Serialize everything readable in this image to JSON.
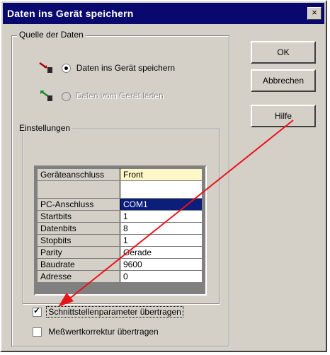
{
  "window": {
    "title": "Daten ins Gerät speichern",
    "close_glyph": "×"
  },
  "source_group": {
    "label": "Quelle der Daten",
    "options": [
      {
        "label": "Daten ins Gerät speichern",
        "selected": true,
        "enabled": true,
        "icon": "upload-arrow-icon"
      },
      {
        "label": "Daten vom Gerät laden",
        "selected": false,
        "enabled": false,
        "icon": "download-arrow-icon"
      }
    ]
  },
  "buttons": {
    "ok": "OK",
    "cancel": "Abbrechen",
    "help": "Hilfe"
  },
  "settings": {
    "label": "Einstellungen",
    "rows": [
      {
        "key": "Geräteanschluss",
        "value": "Front"
      },
      {
        "key": "",
        "value": ""
      },
      {
        "key": "PC-Anschluss",
        "value": "COM1"
      },
      {
        "key": "Startbits",
        "value": "1"
      },
      {
        "key": "Datenbits",
        "value": "8"
      },
      {
        "key": "Stopbits",
        "value": "1"
      },
      {
        "key": "Parity",
        "value": "Gerade"
      },
      {
        "key": "Baudrate",
        "value": "9600"
      },
      {
        "key": "Adresse",
        "value": "0"
      }
    ]
  },
  "checkboxes": [
    {
      "label": "Schnittstellenparameter übertragen",
      "checked": true
    },
    {
      "label": "Meßwertkorrektur übertragen",
      "checked": false
    }
  ],
  "colors": {
    "title_bar": "#08086e",
    "selection": "#0a1e7a",
    "highlight_row": "#fff7c8",
    "annotation_arrow": "#e8131a"
  }
}
